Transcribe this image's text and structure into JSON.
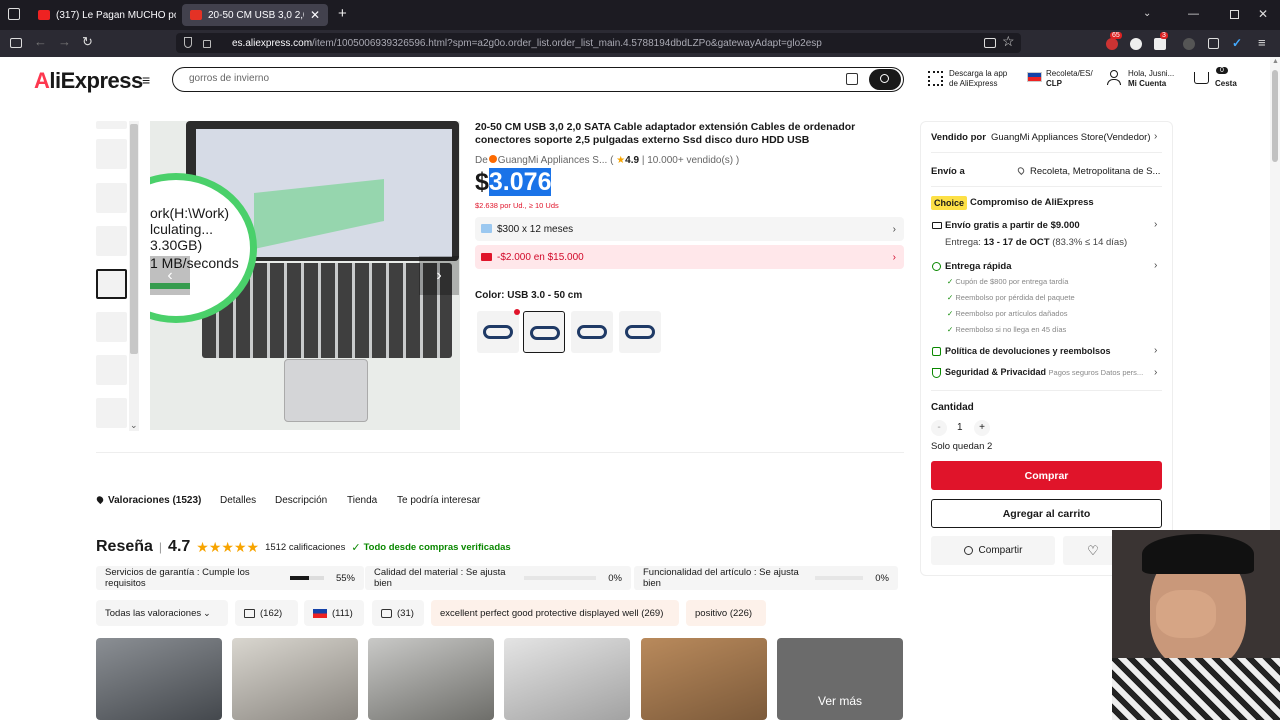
{
  "browser": {
    "tabs": [
      {
        "title": "(317) Le Pagan MUCHO por Pin",
        "active": false
      },
      {
        "title": "20-50 CM USB 3,0 2,0 SATA Ca",
        "active": true
      }
    ],
    "new_tab": "+",
    "url_host": "es.aliexpress.com",
    "url_rest": "/item/1005006939326596.html?spm=a2g0o.order_list.order_list_main.4.5788194dbdLZPo&gatewayAdapt=glo2esp",
    "badges": [
      "65",
      "3"
    ]
  },
  "header": {
    "logo_a": "A",
    "logo_rest": "liExpress",
    "search_placeholder": "gorros de invierno",
    "app_line1": "Descarga la app",
    "app_line2": "de AliExpress",
    "region_line1": "Recoleta/ES/",
    "region_line2": "CLP",
    "account_line1": "Hola, Jusni...",
    "account_line2": "Mi Cuenta",
    "cart_count": "0",
    "cart_label": "Cesta"
  },
  "gallery": {
    "overlay_lines": [
      "ork(H:\\Work)",
      "lculating...",
      "3.30GB)",
      "1 MB/seconds"
    ]
  },
  "product": {
    "title": "20-50 CM USB 3,0 2,0 SATA Cable adaptador extensión Cables de ordenador conectores soporte 2,5 pulgadas externo Ssd disco duro HDD USB",
    "seller_prefix": "De",
    "seller_name": "GuangMi Appliances S...",
    "rating": "4.9",
    "sold": "10.000+ vendido(s)",
    "price_symbol": "$",
    "price_value": "3.076",
    "unit_price": "$2.638 por Ud., ≥ 10 Uds",
    "installment": "$300 x 12 meses",
    "coupon": "-$2.000 en $15.000",
    "color_label": "Color: USB 3.0 - 50 cm"
  },
  "tabs": [
    "Valoraciones (1523)",
    "Detalles",
    "Descripción",
    "Tienda",
    "Te podría interesar"
  ],
  "reviews": {
    "title": "Reseña",
    "score": "4.7",
    "count": "1512 calificaciones",
    "verified": "Todo desde compras verificadas",
    "metrics": [
      {
        "label": "Servicios de garantía : Cumple los requisitos",
        "pct": "55%",
        "fill": 0.55
      },
      {
        "label": "Calidad del material : Se ajusta bien",
        "pct": "0%",
        "fill": 0
      },
      {
        "label": "Funcionalidad del artículo : Se ajusta bien",
        "pct": "0%",
        "fill": 0
      }
    ],
    "filters": {
      "all": "Todas las valoraciones",
      "photos": "(162)",
      "country": "(111)",
      "comments": "(31)",
      "tag1": "excellent perfect good protective displayed well (269)",
      "tag2": "positivo (226)"
    },
    "see_more": "Ver más"
  },
  "panel": {
    "sold_by_label": "Vendido por",
    "sold_by": "GuangMi Appliances Store(Vendedor)",
    "ship_to_label": "Envío a",
    "ship_to": "Recoleta, Metropolitana de S...",
    "choice_badge": "Choice",
    "choice_text": "Compromiso de AliExpress",
    "free_shipping": "Envío gratis a partir de $9.000",
    "delivery_prefix": "Entrega:",
    "delivery_date": "13 - 17 de OCT",
    "delivery_stat": "(83.3% ≤ 14 días)",
    "fast_delivery": "Entrega rápida",
    "perks": [
      "Cupón de $800 por entrega tardía",
      "Reembolso por pérdida del paquete",
      "Reembolso por artículos dañados",
      "Reembolso si no llega en 45 días"
    ],
    "returns": "Política de devoluciones y reembolsos",
    "security": "Seguridad & Privacidad",
    "security_sub": "Pagos seguros Datos pers...",
    "qty_label": "Cantidad",
    "qty_minus": "-",
    "qty_value": "1",
    "qty_plus": "+",
    "stock": "Solo quedan 2",
    "buy": "Comprar",
    "add_cart": "Agregar al carrito",
    "share": "Compartir"
  },
  "colors": {
    "brand_red": "#e0142a",
    "choice_yellow": "#fde046",
    "green": "#0a8800"
  }
}
